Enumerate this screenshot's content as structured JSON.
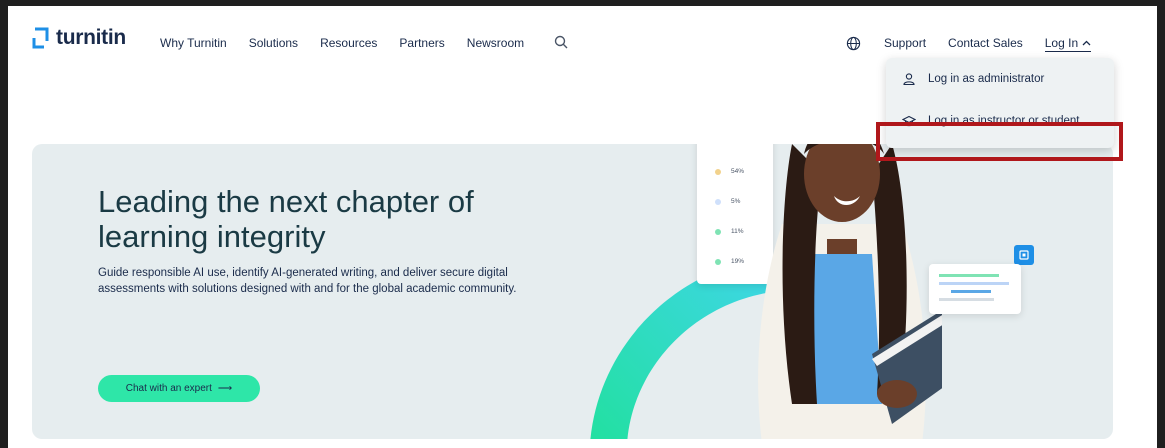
{
  "header": {
    "logo_text": "turnitin",
    "nav": [
      "Why Turnitin",
      "Solutions",
      "Resources",
      "Partners",
      "Newsroom"
    ],
    "right_nav": {
      "support": "Support",
      "contact": "Contact Sales",
      "login": "Log In"
    }
  },
  "dropdown": {
    "admin": "Log in as administrator",
    "student": "Log in as instructor or student"
  },
  "hero": {
    "title": "Leading the next chapter of learning integrity",
    "subtitle": "Guide responsible AI use, identify AI-generated writing, and deliver secure digital assessments with solutions designed with and for the global academic community.",
    "cta": "Chat with an expert",
    "cta_arrow": "⟶"
  },
  "stats_card": [
    {
      "value": "54%",
      "color": "#f2d28c"
    },
    {
      "value": "5%",
      "color": "#cfe0fb"
    },
    {
      "value": "11%",
      "color": "#7fe3b4"
    },
    {
      "value": "19%",
      "color": "#7fe3b4"
    }
  ],
  "colors": {
    "brand": "#1e8fe6",
    "accent": "#2ee6a8",
    "highlight": "#b0171b",
    "text": "#1a2b4b"
  }
}
